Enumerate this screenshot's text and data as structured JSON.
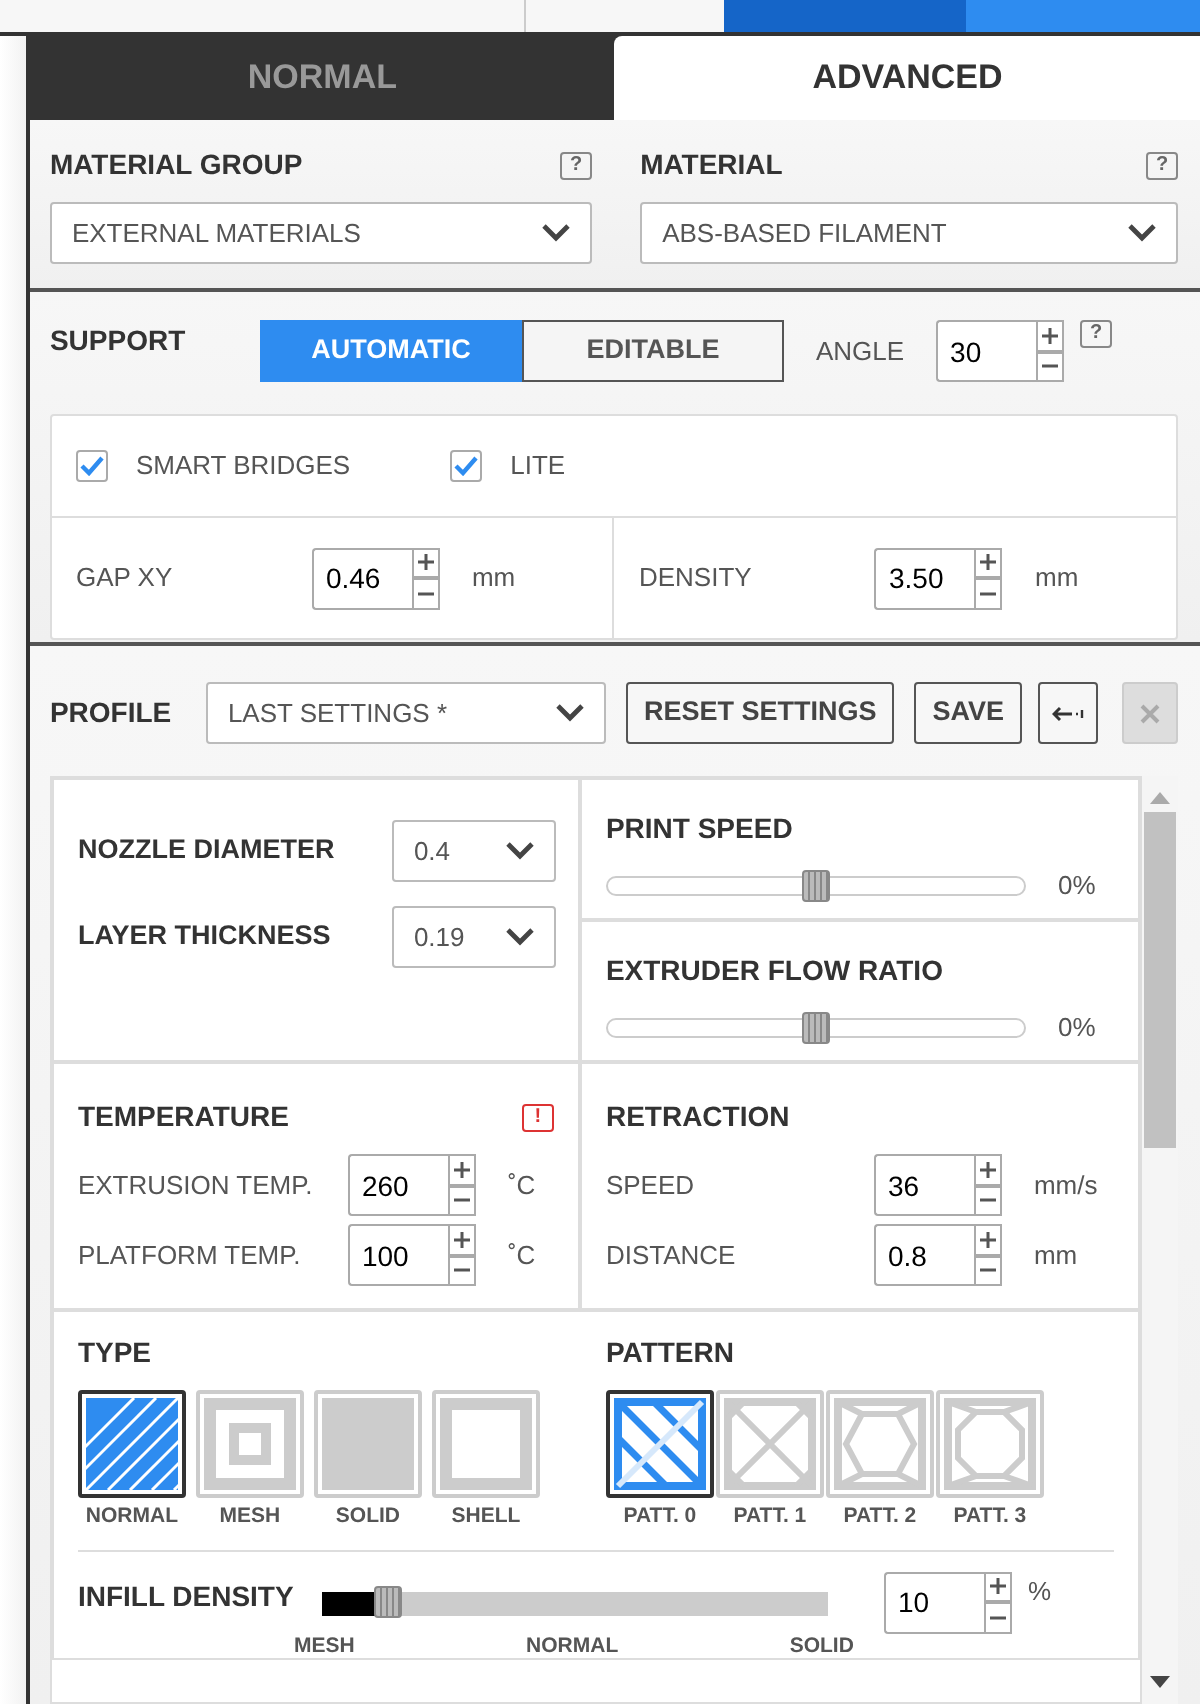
{
  "mode_tabs": [
    {
      "label": "NORMAL",
      "selected": false
    },
    {
      "label": "ADVANCED",
      "selected": true
    }
  ],
  "material": {
    "fields": [
      {
        "label": "MATERIAL GROUP",
        "help": "?",
        "value": "EXTERNAL MATERIALS"
      },
      {
        "label": "MATERIAL",
        "help": "?",
        "value": "ABS-BASED FILAMENT"
      }
    ]
  },
  "support": {
    "title": "SUPPORT",
    "modes": [
      {
        "label": "AUTOMATIC",
        "selected": true
      },
      {
        "label": "EDITABLE",
        "selected": false
      }
    ],
    "angle": {
      "label": "ANGLE",
      "value": "30"
    },
    "help": "?",
    "options": [
      {
        "label": "SMART BRIDGES",
        "checked": true
      },
      {
        "label": "LITE",
        "checked": true
      }
    ],
    "params": [
      {
        "label": "GAP XY",
        "value": "0.46",
        "unit": "mm"
      },
      {
        "label": "DENSITY",
        "value": "3.50",
        "unit": "mm"
      }
    ]
  },
  "profile": {
    "label": "PROFILE",
    "value": "LAST SETTINGS *",
    "buttons": [
      {
        "label": "RESET SETTINGS"
      },
      {
        "label": "SAVE"
      }
    ],
    "icon_buttons": [
      {
        "kind": "back",
        "disabled": false
      },
      {
        "kind": "close",
        "disabled": true
      }
    ]
  },
  "extruder": [
    {
      "label": "NOZZLE DIAMETER",
      "value": "0.4"
    },
    {
      "label": "LAYER THICKNESS",
      "value": "0.19"
    }
  ],
  "sliders": [
    {
      "label": "PRINT SPEED",
      "level": 0.5,
      "reading": "0%"
    },
    {
      "label": "EXTRUDER FLOW RATIO",
      "level": 0.5,
      "reading": "0%"
    }
  ],
  "temperature": {
    "title": "TEMPERATURE",
    "warning": "!",
    "rows": [
      {
        "label": "EXTRUSION TEMP.",
        "value": "260",
        "unit": "˚C"
      },
      {
        "label": "PLATFORM TEMP.",
        "value": "100",
        "unit": "˚C"
      }
    ]
  },
  "retraction": {
    "title": "RETRACTION",
    "rows": [
      {
        "label": "SPEED",
        "value": "36",
        "unit": "mm/s"
      },
      {
        "label": "DISTANCE",
        "value": "0.8",
        "unit": "mm"
      }
    ]
  },
  "infill": {
    "type": {
      "title": "TYPE",
      "items": [
        {
          "kind": "normal",
          "label": "NORMAL",
          "selected": true
        },
        {
          "kind": "mesh",
          "label": "MESH",
          "selected": false
        },
        {
          "kind": "solid",
          "label": "SOLID",
          "selected": false
        },
        {
          "kind": "shell",
          "label": "SHELL",
          "selected": false
        }
      ]
    },
    "pattern": {
      "title": "PATTERN",
      "items": [
        {
          "kind": "diagonal",
          "label": "PATT. 0",
          "selected": true
        },
        {
          "kind": "cross",
          "label": "PATT. 1",
          "selected": false
        },
        {
          "kind": "hexagon",
          "label": "PATT. 2",
          "selected": false
        },
        {
          "kind": "octagon",
          "label": "PATT. 3",
          "selected": false
        }
      ]
    },
    "density": {
      "label": "INFILL DENSITY",
      "level": 0.13,
      "value": "10",
      "unit": "%",
      "scale": [
        "MESH",
        "NORMAL",
        "SOLID"
      ]
    }
  }
}
